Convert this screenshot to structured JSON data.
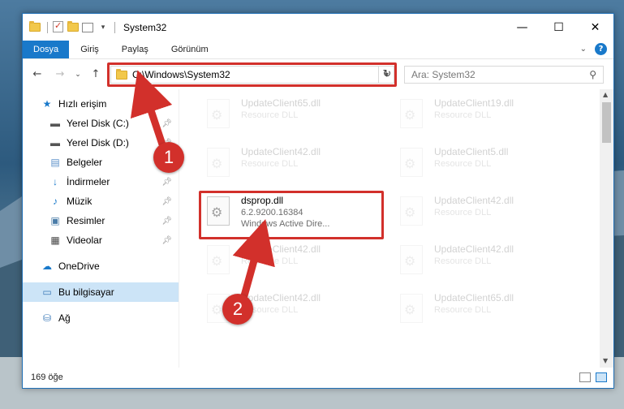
{
  "window": {
    "title": "System32",
    "controls": {
      "minimize": "—",
      "maximize": "☐",
      "close": "✕"
    }
  },
  "ribbon": {
    "tabs": [
      {
        "label": "Dosya",
        "active": true
      },
      {
        "label": "Giriş",
        "active": false
      },
      {
        "label": "Paylaş",
        "active": false
      },
      {
        "label": "Görünüm",
        "active": false
      }
    ],
    "help": "?",
    "expand": "⌄"
  },
  "nav": {
    "back": "←",
    "forward": "→",
    "recent": "⌄",
    "up": "↑"
  },
  "address": {
    "path": "C:\\Windows\\System32",
    "refresh": "↻"
  },
  "search": {
    "placeholder": "Ara: System32",
    "icon": "search-icon"
  },
  "sidebar": {
    "items": [
      {
        "label": "Hızlı erişim",
        "icon": "star-icon",
        "glyph": "★",
        "level": 1,
        "pinned": false
      },
      {
        "label": "Yerel Disk (C:)",
        "icon": "drive-icon",
        "glyph": "▬",
        "level": 2,
        "pinned": true
      },
      {
        "label": "Yerel Disk (D:)",
        "icon": "drive-icon",
        "glyph": "▬",
        "level": 2,
        "pinned": true
      },
      {
        "label": "Belgeler",
        "icon": "documents-icon",
        "glyph": "▤",
        "level": 2,
        "pinned": true
      },
      {
        "label": "İndirmeler",
        "icon": "download-icon",
        "glyph": "↓",
        "level": 2,
        "pinned": true
      },
      {
        "label": "Müzik",
        "icon": "music-icon",
        "glyph": "♪",
        "level": 2,
        "pinned": true
      },
      {
        "label": "Resimler",
        "icon": "pictures-icon",
        "glyph": "▣",
        "level": 2,
        "pinned": true
      },
      {
        "label": "Videolar",
        "icon": "video-icon",
        "glyph": "▦",
        "level": 2,
        "pinned": true
      },
      {
        "label": "OneDrive",
        "icon": "cloud-icon",
        "glyph": "☁",
        "level": 1,
        "pinned": false
      },
      {
        "label": "Bu bilgisayar",
        "icon": "computer-icon",
        "glyph": "▭",
        "level": 1,
        "pinned": false,
        "selected": true
      },
      {
        "label": "Ağ",
        "icon": "network-icon",
        "glyph": "⛁",
        "level": 1,
        "pinned": false
      }
    ]
  },
  "files": {
    "left": [
      {
        "name": "UpdateClient65.dll",
        "desc": "Resource DLL",
        "faded": true
      },
      {
        "name": "UpdateClient42.dll",
        "desc": "Resource DLL",
        "faded": true
      },
      {
        "name": "dsprop.dll",
        "version": "6.2.9200.16384",
        "desc": "Windows Active Dire...",
        "faded": false
      },
      {
        "name": "UpdateClient42.dll",
        "desc": "Resource DLL",
        "faded": true
      },
      {
        "name": "UpdateClient42.dll",
        "desc": "Resource DLL",
        "faded": true
      }
    ],
    "right": [
      {
        "name": "UpdateClient19.dll",
        "desc": "Resource DLL",
        "faded": true
      },
      {
        "name": "UpdateClient5.dll",
        "desc": "Resource DLL",
        "faded": true
      },
      {
        "name": "UpdateClient42.dll",
        "desc": "Resource DLL",
        "faded": true
      },
      {
        "name": "UpdateClient42.dll",
        "desc": "Resource DLL",
        "faded": true
      },
      {
        "name": "UpdateClient65.dll",
        "desc": "Resource DLL",
        "faded": true
      }
    ]
  },
  "status": {
    "count": "169 öğe"
  },
  "annotations": [
    {
      "label": "1",
      "color": "#d2302b"
    },
    {
      "label": "2",
      "color": "#d2302b"
    }
  ]
}
